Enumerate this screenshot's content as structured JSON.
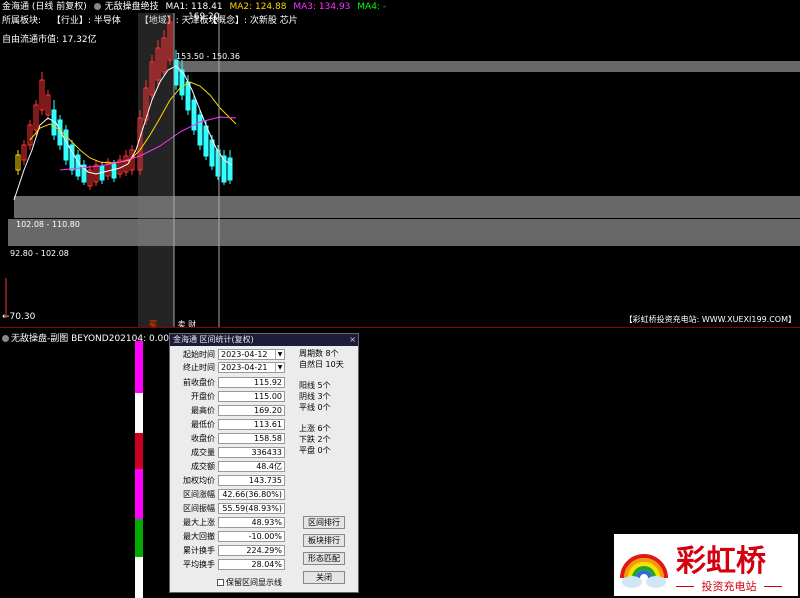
{
  "main_chart": {
    "title": "金海通 (日线 前复权)",
    "indicator": "无敌操盘绝技",
    "ma": [
      {
        "label": "MA1: 118.41",
        "color": "#ffffff"
      },
      {
        "label": "MA2: 124.88",
        "color": "#ffd700"
      },
      {
        "label": "MA3: 134.93",
        "color": "#ff33ff"
      },
      {
        "label": "MA4: -",
        "color": "#00ff00"
      }
    ],
    "info_line": {
      "sector_label": "所属板块:",
      "industry": "【行业】: 半导体",
      "region": "【地域】: 天津板块",
      "concept": "【概念】: 次新股 芯片"
    },
    "float_cap": "自由流通市值: 17.32亿",
    "top_price": "169.20",
    "bands": {
      "upper": "153.50 - 150.36",
      "middle": "102.08 - 110.80",
      "lower": "92.80 - 102.08"
    },
    "low_price": "←70.30",
    "markers": {
      "left": "买",
      "right": "卖 财"
    },
    "footer_ad": "【彩虹桥投资充电站: WWW.XUEXI199.COM】"
  },
  "sub_chart": {
    "title": "无敌操盘-副图 BEYOND202104: 0.00"
  },
  "dialog": {
    "app": "金海通",
    "title": "区间统计(复权)",
    "close": "×",
    "start_label": "起始时间",
    "start_value": "2023-04-12",
    "end_label": "终止时间",
    "end_value": "2023-04-21",
    "fields": [
      {
        "label": "前收盘价",
        "value": "115.92"
      },
      {
        "label": "开盘价",
        "value": "115.00"
      },
      {
        "label": "最高价",
        "value": "169.20"
      },
      {
        "label": "最低价",
        "value": "113.61"
      },
      {
        "label": "收盘价",
        "value": "158.58"
      },
      {
        "label": "成交量",
        "value": "336433"
      },
      {
        "label": "成交额",
        "value": "48.4亿"
      },
      {
        "label": "加权均价",
        "value": "143.735"
      },
      {
        "label": "区间涨幅",
        "value": "42.66(36.80%)"
      },
      {
        "label": "区间振幅",
        "value": "55.59(48.93%)"
      },
      {
        "label": "最大上涨",
        "value": "48.93%"
      },
      {
        "label": "最大回撤",
        "value": "-10.00%"
      },
      {
        "label": "累计换手",
        "value": "224.29%"
      },
      {
        "label": "平均换手",
        "value": "28.04%"
      }
    ],
    "stats": {
      "periods": "周期数 8个",
      "natural_days": "自然日 10天",
      "yang": "阳线 5个",
      "yin": "阴线 3个",
      "flat_line": "平线 0个",
      "up": "上涨 6个",
      "down": "下跌 2个",
      "flat": "平盘 0个"
    },
    "buttons": {
      "rank": "区间排行",
      "sector_rank": "板块排行",
      "pattern": "形态匹配",
      "close": "关闭"
    },
    "checkbox": "保留区间显示线"
  },
  "logo": {
    "name": "彩虹桥",
    "subtitle": "投资充电站"
  },
  "colors": {
    "up": "#ff3333",
    "down": "#33ffff",
    "ma1": "#ffffff",
    "ma2": "#ffd700",
    "ma3": "#ff33ff",
    "band": "#7a7a7a",
    "logo_red": "#d4000f"
  }
}
